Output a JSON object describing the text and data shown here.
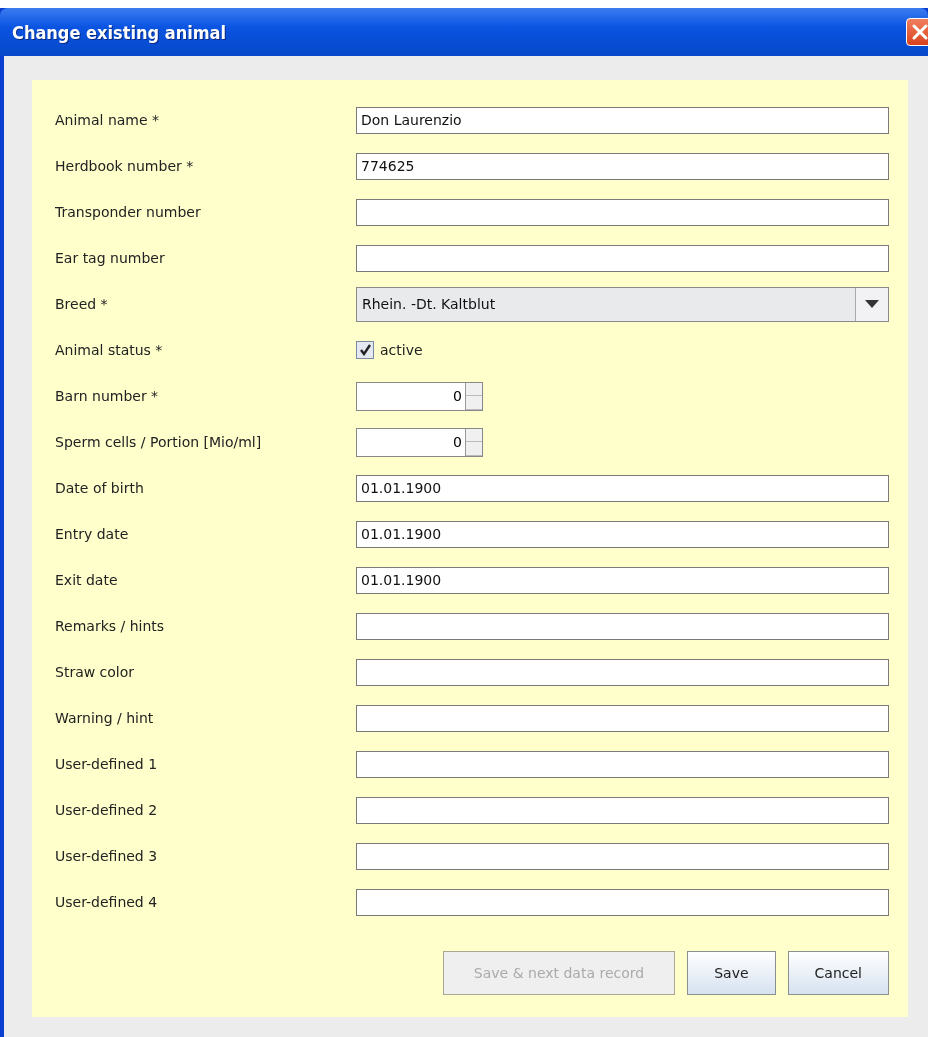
{
  "window": {
    "title": "Change existing animal"
  },
  "fields": [
    {
      "kind": "text",
      "label": "Animal name *",
      "value": "Don Laurenzio"
    },
    {
      "kind": "text",
      "label": "Herdbook number *",
      "value": "774625"
    },
    {
      "kind": "text",
      "label": "Transponder number"
    },
    {
      "kind": "text",
      "label": "Ear tag number"
    },
    {
      "kind": "combo",
      "label": "Breed *",
      "value": "Rhein. -Dt. Kaltblut"
    },
    {
      "kind": "checkbox",
      "label": "Animal status *",
      "text": "active",
      "checked": true
    },
    {
      "kind": "spinner",
      "label": "Barn number *",
      "value": "0"
    },
    {
      "kind": "spinner",
      "label": "Sperm cells / Portion [Mio/ml]",
      "value": "0"
    },
    {
      "kind": "text",
      "label": "Date of birth",
      "value": "01.01.1900"
    },
    {
      "kind": "text",
      "label": "Entry date",
      "value": "01.01.1900"
    },
    {
      "kind": "text",
      "label": "Exit date",
      "value": "01.01.1900"
    },
    {
      "kind": "text",
      "label": "Remarks / hints"
    },
    {
      "kind": "text",
      "label": "Straw color"
    },
    {
      "kind": "text",
      "label": "Warning / hint"
    },
    {
      "kind": "text",
      "label": "User-defined 1"
    },
    {
      "kind": "text",
      "label": "User-defined 2"
    },
    {
      "kind": "text",
      "label": "User-defined 3"
    },
    {
      "kind": "text",
      "label": "User-defined 4"
    }
  ],
  "buttons": [
    {
      "label": "Save & next data record",
      "disabled": true
    },
    {
      "label": "Save",
      "disabled": false
    },
    {
      "label": "Cancel",
      "disabled": false
    }
  ]
}
